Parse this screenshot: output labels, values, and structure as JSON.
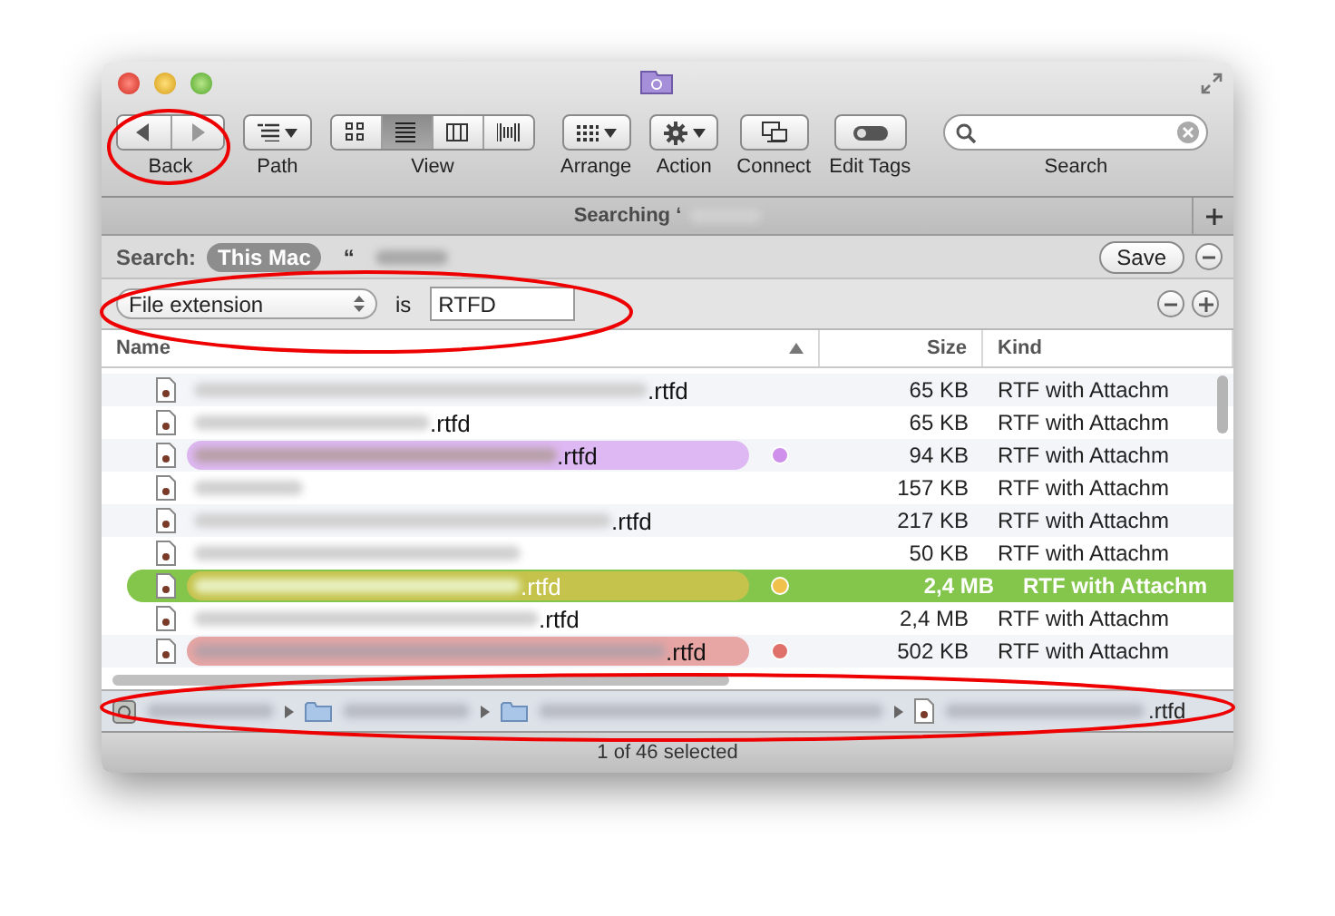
{
  "toolbar": [
    {
      "kind": "nav",
      "label": "Back"
    },
    {
      "kind": "path",
      "label": "Path"
    },
    {
      "kind": "view",
      "label": "View",
      "modes": [
        {
          "selected": false
        },
        {
          "selected": true
        },
        {
          "selected": false
        },
        {
          "selected": false
        }
      ]
    },
    {
      "kind": "arrange",
      "label": "Arrange"
    },
    {
      "kind": "action",
      "label": "Action"
    },
    {
      "kind": "connect",
      "label": "Connect"
    },
    {
      "kind": "tags",
      "label": "Edit Tags"
    },
    {
      "kind": "search",
      "label": "Search"
    }
  ],
  "tab_title": "Searching ‘",
  "search_bar": {
    "label": "Search:",
    "scopes": [
      {
        "label": "This Mac",
        "selected": true
      },
      {
        "label": "“",
        "selected": false
      }
    ],
    "save": "Save"
  },
  "criteria": {
    "attribute": "File extension",
    "operator": "is",
    "value": "RTFD"
  },
  "columns": [
    {
      "label": "Name",
      "sorted": true
    },
    {
      "label": "Size",
      "sorted": false
    },
    {
      "label": "Kind",
      "sorted": false
    }
  ],
  "rows": [
    {
      "suffix": ".rtfd",
      "size": "65 KB",
      "kind": "RTF with Attachm",
      "selected": false
    },
    {
      "suffix": ".rtfd",
      "size": "65 KB",
      "kind": "RTF with Attachm",
      "selected": false
    },
    {
      "suffix": ".rtfd",
      "size": "94 KB",
      "kind": "RTF with Attachm",
      "selected": false,
      "color": "#cf90ec"
    },
    {
      "size": "157 KB",
      "kind": "RTF with Attachm",
      "selected": false
    },
    {
      "suffix": ".rtfd",
      "size": "217 KB",
      "kind": "RTF with Attachm",
      "selected": false
    },
    {
      "size": "50 KB",
      "kind": "RTF with Attachm",
      "selected": false
    },
    {
      "suffix": ".rtfd",
      "size": "2,4 MB",
      "kind": "RTF with Attachm",
      "selected": true,
      "color": "#f0c24c"
    },
    {
      "suffix": ".rtfd",
      "size": "2,4 MB",
      "kind": "RTF with Attachm",
      "selected": false
    },
    {
      "suffix": ".rtfd",
      "size": "502 KB",
      "kind": "RTF with Attachm",
      "selected": false,
      "color": "#e0706a"
    }
  ],
  "path_bar": {
    "items": [
      {
        "kind": "disk"
      },
      {
        "kind": "folder"
      },
      {
        "kind": "folder"
      },
      {
        "kind": "file",
        "suffix": ".rtfd"
      }
    ]
  },
  "status": "1 of 46 selected"
}
